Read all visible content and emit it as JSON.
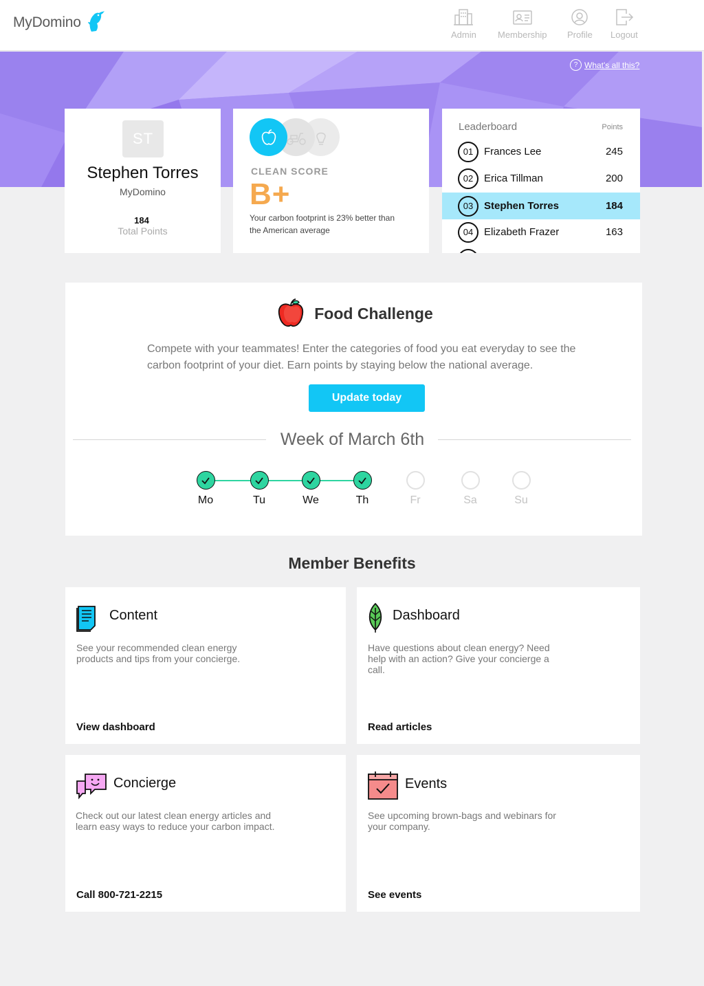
{
  "header": {
    "brand": "MyDomino",
    "nav": [
      {
        "label": "Admin",
        "icon": "building-icon"
      },
      {
        "label": "Membership",
        "icon": "id-card-icon"
      },
      {
        "label": "Profile",
        "icon": "user-circle-icon"
      },
      {
        "label": "Logout",
        "icon": "logout-icon"
      }
    ]
  },
  "banner": {
    "help_icon": "?",
    "help_link": "What's all this?"
  },
  "profile": {
    "initials": "ST",
    "name": "Stephen Torres",
    "org": "MyDomino",
    "points": "184",
    "points_label": "Total Points"
  },
  "clean_score": {
    "icons": [
      "apple-icon",
      "scooter-icon",
      "lightbulb-icon"
    ],
    "title": "CLEAN SCORE",
    "grade": "B+",
    "description": "Your carbon footprint is 23% better than the American average"
  },
  "leaderboard": {
    "title": "Leaderboard",
    "points_header": "Points",
    "rows": [
      {
        "rank": "01",
        "name": "Frances Lee",
        "points": "245"
      },
      {
        "rank": "02",
        "name": "Erica Tillman",
        "points": "200"
      },
      {
        "rank": "03",
        "name": "Stephen Torres",
        "points": "184",
        "highlighted": true
      },
      {
        "rank": "04",
        "name": "Elizabeth Frazer",
        "points": "163"
      }
    ]
  },
  "food_challenge": {
    "title": "Food Challenge",
    "description": "Compete with your teammates! Enter the categories of food you eat everyday to see the carbon footprint of your diet. Earn points by staying below the national average.",
    "button": "Update today",
    "week_title": "Week of March 6th",
    "days": [
      {
        "label": "Mo",
        "done": true
      },
      {
        "label": "Tu",
        "done": true
      },
      {
        "label": "We",
        "done": true
      },
      {
        "label": "Th",
        "done": true
      },
      {
        "label": "Fr",
        "done": false
      },
      {
        "label": "Sa",
        "done": false
      },
      {
        "label": "Su",
        "done": false
      }
    ]
  },
  "benefits": {
    "title": "Member Benefits",
    "cards": [
      {
        "title": "Content",
        "description": "See your recommended clean energy products and tips from your concierge.",
        "link": "View dashboard",
        "icon": "document-icon"
      },
      {
        "title": "Dashboard",
        "description": "Have questions about clean energy? Need help with an action? Give your concierge a call.",
        "link": "Read articles",
        "icon": "leaf-icon"
      },
      {
        "title": "Concierge",
        "description": "Check out our latest clean energy articles and learn easy ways to reduce your carbon impact.",
        "link": "Call 800-721-2215",
        "icon": "chat-bubbles-icon"
      },
      {
        "title": "Events",
        "description": "See upcoming brown-bags and webinars for your company.",
        "link": "See events",
        "icon": "calendar-check-icon"
      }
    ]
  },
  "colors": {
    "accent": "#12c6f5",
    "highlight_row": "#a6e8fb",
    "check_green": "#2ed5a0",
    "grade_orange": "#f5a94f",
    "banner_purple": "#a58cf4"
  }
}
